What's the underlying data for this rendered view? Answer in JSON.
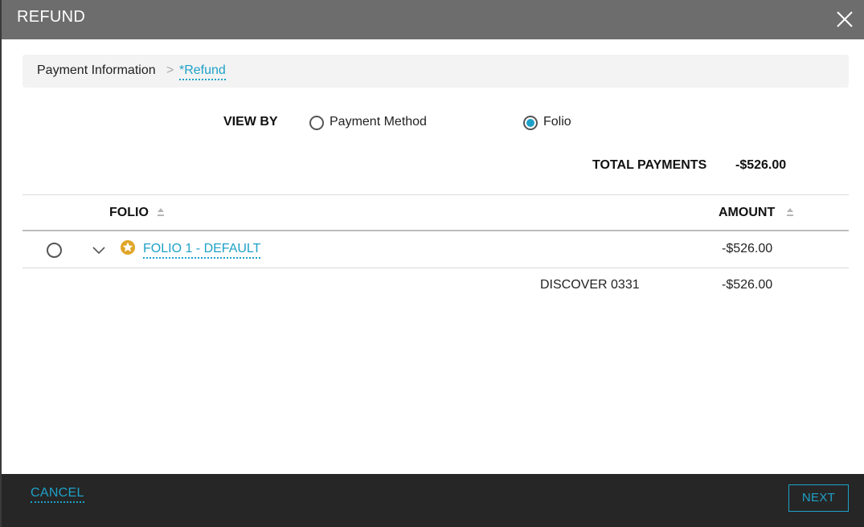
{
  "dialog": {
    "title": "REFUND",
    "close_icon": "close-icon"
  },
  "breadcrumb": {
    "items": [
      "Payment Information",
      "*Refund"
    ],
    "separator": ">"
  },
  "view_by": {
    "label": "VIEW BY",
    "options": [
      {
        "label": "Payment Method",
        "selected": false
      },
      {
        "label": "Folio",
        "selected": true
      }
    ]
  },
  "totals": {
    "label": "TOTAL PAYMENTS",
    "value": "-$526.00"
  },
  "table": {
    "columns": [
      "FOLIO",
      "AMOUNT"
    ],
    "rows": [
      {
        "folio": "FOLIO 1 - DEFAULT",
        "amount": "-$526.00",
        "selected": false,
        "expanded": true,
        "default_icon": "star-icon",
        "children": [
          {
            "method": "DISCOVER 0331",
            "amount": "-$526.00"
          }
        ]
      }
    ]
  },
  "footer": {
    "cancel_label": "CANCEL",
    "next_label": "NEXT"
  },
  "colors": {
    "accent": "#1ea1c8",
    "titlebar": "#6d6d6d",
    "footer": "#262626",
    "star": "#e0a528"
  }
}
